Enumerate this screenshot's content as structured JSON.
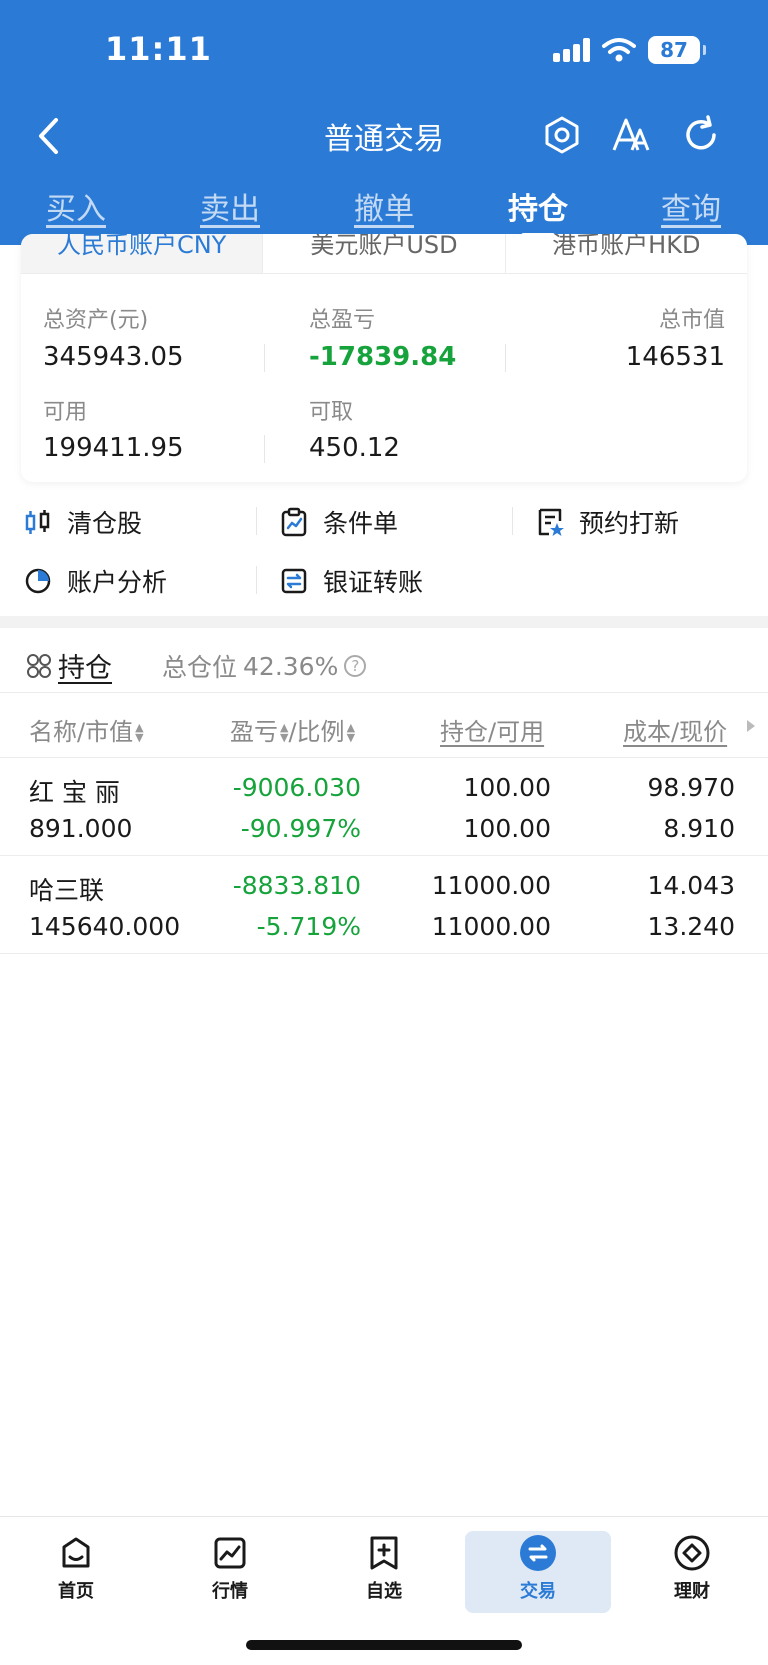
{
  "status": {
    "time": "11:11",
    "battery": "87"
  },
  "nav": {
    "title": "普通交易"
  },
  "tabs": [
    "买入",
    "卖出",
    "撤单",
    "持仓",
    "查询"
  ],
  "account_tabs": [
    "人民币账户CNY",
    "美元账户USD",
    "港币账户HKD"
  ],
  "summary": {
    "total_assets_label": "总资产(元)",
    "total_assets": "345943.05",
    "total_pnl_label": "总盈亏",
    "total_pnl": "-17839.84",
    "market_value_label": "总市值",
    "market_value": "146531",
    "available_label": "可用",
    "available": "199411.95",
    "withdrawable_label": "可取",
    "withdrawable": "450.12"
  },
  "actions": [
    "清仓股",
    "条件单",
    "预约打新",
    "账户分析",
    "银证转账"
  ],
  "holdings": {
    "title": "持仓",
    "ratio_label": "总仓位",
    "ratio": "42.36%",
    "columns": [
      "名称/市值",
      "盈亏",
      "/比例",
      "持仓/可用",
      "成本/现价"
    ],
    "rows": [
      {
        "name": "红 宝 丽",
        "market_value": "891.000",
        "pnl": "-9006.030",
        "pnl_pct": "-90.997%",
        "position": "100.00",
        "available": "100.00",
        "cost": "98.970",
        "price": "8.910"
      },
      {
        "name": "哈三联",
        "market_value": "145640.000",
        "pnl": "-8833.810",
        "pnl_pct": "-5.719%",
        "position": "11000.00",
        "available": "11000.00",
        "cost": "14.043",
        "price": "13.240"
      }
    ]
  },
  "bottom_nav": [
    "首页",
    "行情",
    "自选",
    "交易",
    "理财"
  ],
  "colors": {
    "primary": "#2b7bd6",
    "loss": "#16a33b"
  }
}
